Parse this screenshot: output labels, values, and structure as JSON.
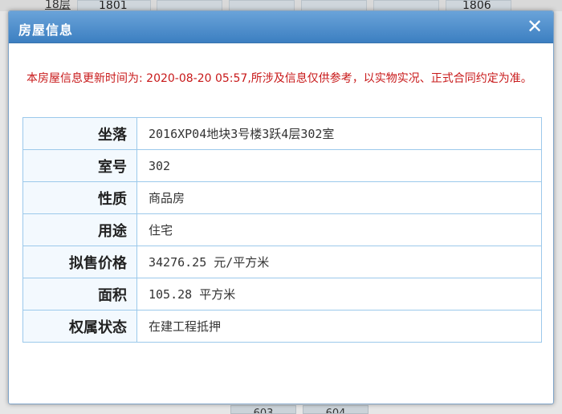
{
  "background": {
    "floor_label": "18层",
    "top_cells": [
      {
        "label": "1801"
      },
      {
        "label": ""
      },
      {
        "label": ""
      },
      {
        "label": ""
      },
      {
        "label": ""
      },
      {
        "label": "1806"
      }
    ],
    "bottom_cells": [
      {
        "label": "603"
      },
      {
        "label": "604"
      }
    ]
  },
  "dialog": {
    "title": "房屋信息",
    "close_icon": "close-icon",
    "notice": "本房屋信息更新时间为: 2020-08-20 05:57,所涉及信息仅供参考，以实物实况、正式合同约定为准。",
    "rows": [
      {
        "label": "坐落",
        "value": "2016XP04地块3号楼3跃4层302室"
      },
      {
        "label": "室号",
        "value": "302"
      },
      {
        "label": "性质",
        "value": "商品房"
      },
      {
        "label": "用途",
        "value": "住宅"
      },
      {
        "label": "拟售价格",
        "value": "34276.25 元/平方米"
      },
      {
        "label": "面积",
        "value": "105.28 平方米"
      },
      {
        "label": "权属状态",
        "value": "在建工程抵押"
      }
    ]
  },
  "colors": {
    "title_bar": "#3c7fc1",
    "notice_text": "#c8191a",
    "table_border": "#9cc9eb"
  }
}
